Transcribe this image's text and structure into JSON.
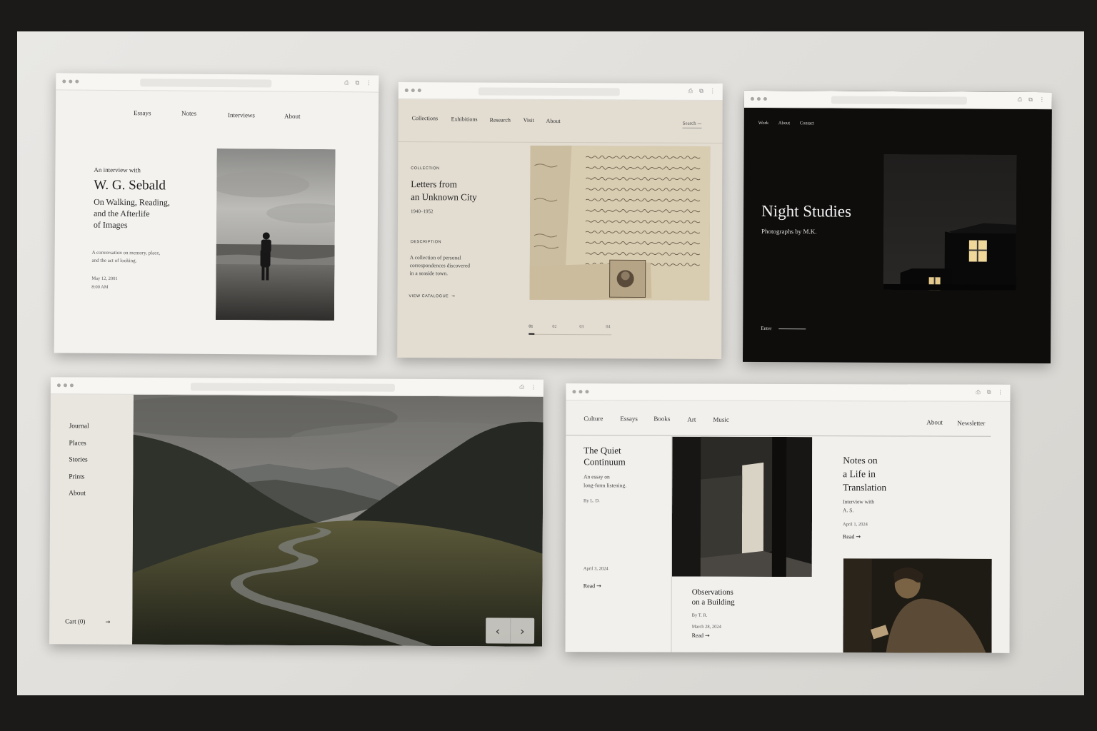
{
  "w1": {
    "nav": [
      "Essays",
      "Notes",
      "Interviews",
      "About"
    ],
    "kicker": "An interview with",
    "name": "W. G. Sebald",
    "sub": [
      "On Walking, Reading,",
      "and the Afterlife",
      "of Images"
    ],
    "desc": [
      "A conversation on memory, place,",
      "and the act of looking."
    ],
    "date": "May 12, 2001",
    "time": "8:00 AM"
  },
  "w2": {
    "nav": [
      "Collections",
      "Exhibitions",
      "Research",
      "Visit",
      "About"
    ],
    "search": "Search",
    "label": "COLLECTION",
    "title": [
      "Letters from",
      "an Unknown City"
    ],
    "years": "1940–1952",
    "desc_label": "DESCRIPTION",
    "desc": [
      "A collection of personal",
      "correspondences discovered",
      "in a seaside town."
    ],
    "cta": "VIEW CATALOGUE",
    "pages": [
      "01",
      "02",
      "03",
      "04"
    ]
  },
  "w3": {
    "nav": [
      "Work",
      "About",
      "Contact"
    ],
    "title": "Night Studies",
    "sub": "Photographs by M.K.",
    "enter": "Enter"
  },
  "w4": {
    "nav": [
      "Journal",
      "Places",
      "Stories",
      "Prints",
      "About"
    ],
    "cart": "Cart (0)"
  },
  "w5": {
    "nav": [
      "Culture",
      "Essays",
      "Books",
      "Art",
      "Music"
    ],
    "nav_right": [
      "About",
      "Newsletter"
    ],
    "a1": {
      "title": [
        "The Quiet",
        "Continuum"
      ],
      "desc": [
        "An essay on",
        "long-form listening."
      ],
      "by": "By L. D.",
      "date": "April 3, 2024",
      "read": "Read"
    },
    "a2": {
      "title": [
        "Observations",
        "on a Building"
      ],
      "by": "By T. R.",
      "date": "March 28, 2024",
      "read": "Read"
    },
    "a3": {
      "title": [
        "Notes on",
        "a Life in",
        "Translation"
      ],
      "desc": [
        "Interview with",
        "A. S."
      ],
      "date": "April 1, 2024",
      "read": "Read"
    }
  },
  "icons": {
    "arrow": "→",
    "prev": "‹",
    "next": "›"
  },
  "colors": {
    "dark": "#0e0d0c",
    "beige": "#e2dcd1"
  }
}
